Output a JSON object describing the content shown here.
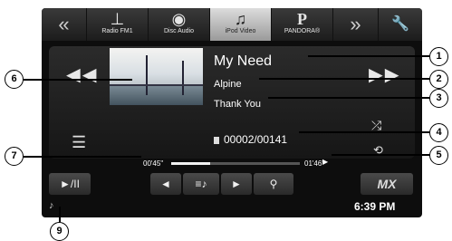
{
  "top_bar": {
    "prev_arrow": "«",
    "sources": [
      {
        "label": "Radio FM1",
        "icon": "antenna-icon",
        "glyph": "⊥"
      },
      {
        "label": "Disc Audio",
        "icon": "disc-icon",
        "glyph": "◉"
      },
      {
        "label": "iPod Video",
        "icon": "music-note-icon",
        "glyph": "♫"
      },
      {
        "label": "PANDORA®",
        "icon": "pandora-icon",
        "glyph": "P"
      }
    ],
    "next_arrow": "»",
    "settings_glyph": "🔧"
  },
  "track": {
    "title": "My Need",
    "artist": "Alpine",
    "album": "Thank You",
    "counter": "00002/00141"
  },
  "progress": {
    "elapsed": "00'45\"",
    "remaining": "01'46\"",
    "fraction": 0.3
  },
  "controls": {
    "play_pause": "►/II",
    "prev": "◄",
    "browse": "≡♪",
    "next": "►",
    "search": "⚲",
    "mx_label": "MX"
  },
  "status": {
    "clock": "6:39 PM",
    "note": "♪"
  },
  "callouts": [
    "1",
    "2",
    "3",
    "4",
    "5",
    "6",
    "7",
    "9"
  ]
}
